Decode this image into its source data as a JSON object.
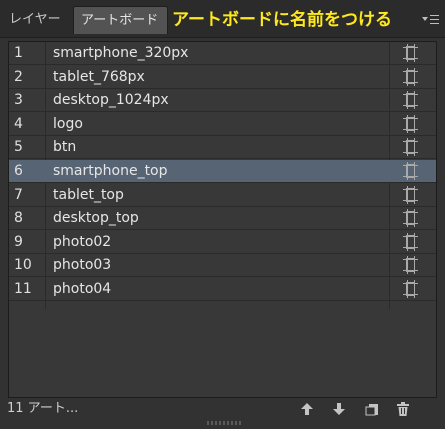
{
  "tabs": {
    "layers_label": "レイヤー",
    "artboards_label": "アートボード"
  },
  "title_overlay": "アートボードに名前をつける",
  "icons": {
    "panel_menu": "panel-menu-icon",
    "artboard": "artboard-icon",
    "move_up": "arrow-up-icon",
    "move_down": "arrow-down-icon",
    "new_artboard": "new-artboard-icon",
    "delete": "trash-icon"
  },
  "artboards": [
    {
      "num": "1",
      "name": "smartphone_320px"
    },
    {
      "num": "2",
      "name": "tablet_768px"
    },
    {
      "num": "3",
      "name": "desktop_1024px"
    },
    {
      "num": "4",
      "name": "logo"
    },
    {
      "num": "5",
      "name": "btn"
    },
    {
      "num": "6",
      "name": "smartphone_top"
    },
    {
      "num": "7",
      "name": "tablet_top"
    },
    {
      "num": "8",
      "name": "desktop_top"
    },
    {
      "num": "9",
      "name": "photo02"
    },
    {
      "num": "10",
      "name": "photo03"
    },
    {
      "num": "11",
      "name": "photo04"
    }
  ],
  "selected_index": 5,
  "footer": {
    "count_label": "11 アート..."
  },
  "colors": {
    "panel_bg": "#323232",
    "selected_row": "#576474",
    "title_overlay": "#ffe81f"
  }
}
